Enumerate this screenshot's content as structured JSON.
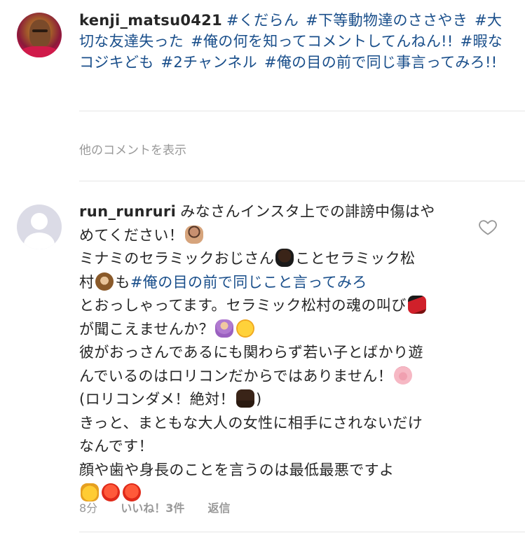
{
  "post": {
    "username": "kenji_matsu0421",
    "hashtags": [
      "#くだらん",
      "#下等動物達のささやき",
      "#大切な友達失った",
      "#俺の何を知ってコメントしてんねん!!",
      "#暇なコジキども",
      "#2チャンネル",
      "#俺の目の前で同じ事言ってみろ!!"
    ]
  },
  "view_more_label": "他のコメントを表示",
  "comment": {
    "username": "run_runruri",
    "lines": [
      "みなさんインスタ上での誹謗中傷はや",
      "めてください！",
      "ミナミのセラミックおじさん",
      "ことセラミック松",
      "村",
      "も",
      "#俺の目の前で同じこと言ってみろ",
      "とおっしゃってます。セラミック松村の魂の叫び",
      "が聞こえませんか？",
      "彼がおっさんであるにも関わらず若い子とばかり遊",
      "んでいるのはロリコンだからではありません！",
      "(ロリコンダメ！絶対！",
      ")",
      "きっと、まともな大人の女性に相手にされないだけ",
      "なんです！",
      "顔や歯や身長のことを言うのは最低最悪ですよ"
    ],
    "emojis": {
      "cross": "person-gesturing-no-emoji",
      "man": "man-emoji",
      "monkey": "monkey-emoji",
      "dancer": "dancer-emoji",
      "shrug": "person-shrugging-emoji",
      "shush": "shushing-face-emoji",
      "pig": "pig-face-emoji",
      "thumb": "thumbs-down-emoji",
      "cat": "pouting-cat-emoji",
      "angry": "angry-face-emoji"
    },
    "time": "8分",
    "likes": "いいね！3件",
    "reply": "返信"
  },
  "colors": {
    "hashtag": "#1a4f8b",
    "muted": "#999999",
    "divider": "#e6e6e6",
    "text": "#262626"
  }
}
